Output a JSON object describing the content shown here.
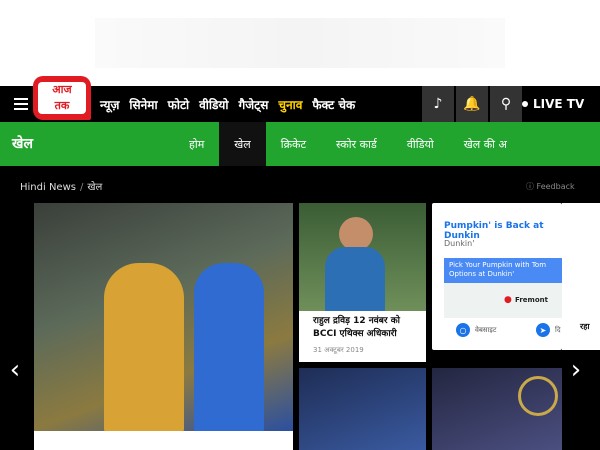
{
  "logo": {
    "line1": "आज",
    "line2": "तक"
  },
  "nav": {
    "items": [
      "न्यूज़",
      "सिनेमा",
      "फोटो",
      "वीडियो",
      "गैजेट्स",
      "चुनाव",
      "फैक्ट चेक"
    ],
    "highlighted": "चुनाव"
  },
  "header_icons": [
    "headphones-icon",
    "bell-icon",
    "search-icon"
  ],
  "live": {
    "label": "LIVE TV"
  },
  "section": {
    "title": "खेल",
    "tabs": [
      "होम",
      "खेल",
      "क्रिकेट",
      "स्कोर कार्ड",
      "वीडियो",
      "खेल की अ"
    ],
    "active_tab": "खेल"
  },
  "breadcrumb": {
    "home": "Hindi News",
    "separator": "/",
    "current": "खेल"
  },
  "feedback": {
    "label": "Feedback"
  },
  "cards": [
    {
      "title": "राहुल द्रविड़ 12 नवंबर को BCCI एथिक्स अधिकारी",
      "date": "31 अक्टूबर 2019"
    }
  ],
  "ad": {
    "headline": "Pumpkin' is Back at Dunkin",
    "sponsor": "Dunkin'",
    "banner": "Pick Your Pumpkin with Tom Options at Dunkin'",
    "location": "Fremont",
    "button1": "वेबसाइट",
    "button2": "दि"
  },
  "sliver_text": "रहा",
  "colors": {
    "brand_red": "#e01b22",
    "sports_green": "#21a52f",
    "highlight_yellow": "#ffd400",
    "ad_blue": "#1a73e8"
  }
}
